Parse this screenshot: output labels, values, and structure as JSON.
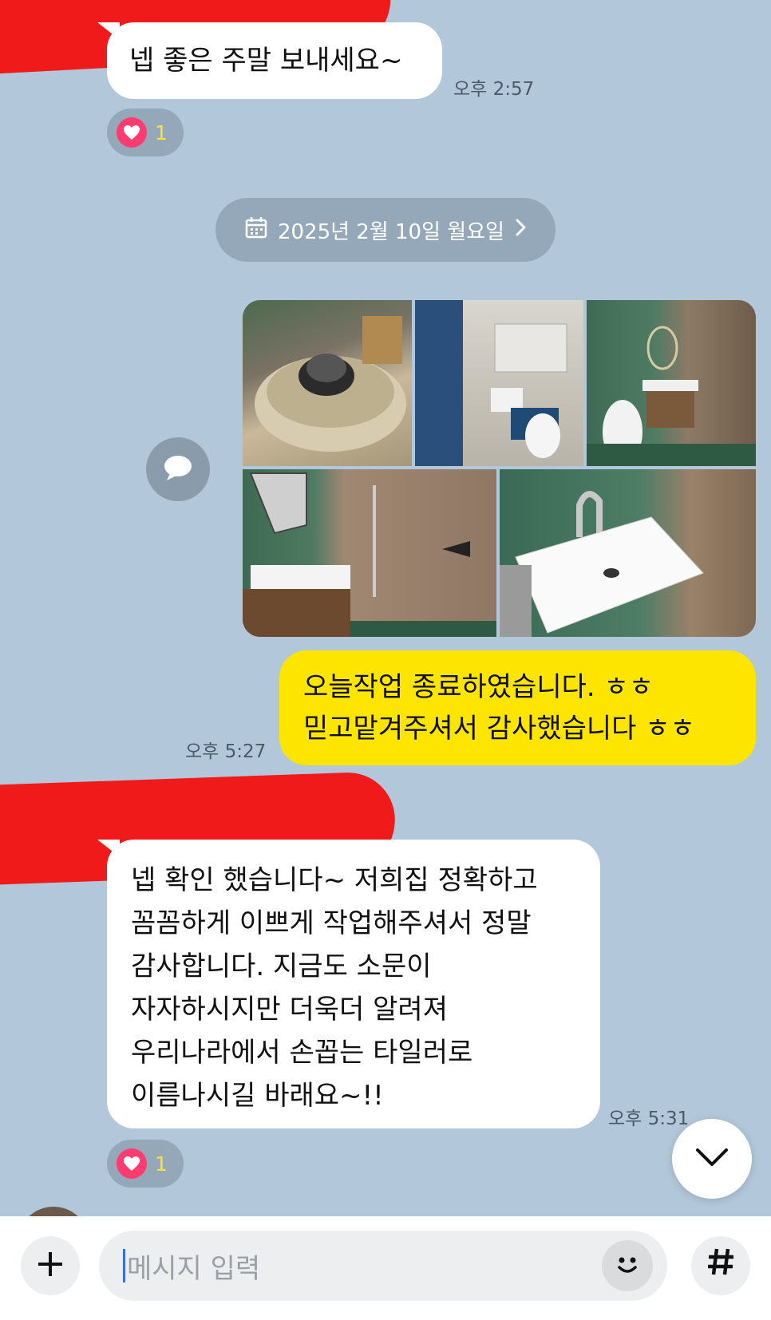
{
  "messages": [
    {
      "side": "left",
      "text": "넵 좋은 주말 보내세요~",
      "time": "오후 2:57",
      "reaction_count": "1"
    },
    {
      "side": "right",
      "lines": [
        "오늘작업 종료하였습니다. ㅎㅎ",
        "믿고맡겨주셔서 감사했습니다 ㅎㅎ"
      ],
      "time": "오후 5:27"
    },
    {
      "side": "left",
      "lines": [
        "넵 확인 했습니다~ 저희집 정확하고",
        "꼼꼼하게 이쁘게 작업해주셔서 정말",
        "감사합니다. 지금도 소문이",
        "자자하시지만 더욱더 알려져",
        "우리나라에서 손꼽는 타일러로",
        "이름나시길 바래요~!!"
      ],
      "time": "오후 5:31",
      "reaction_count": "1"
    }
  ],
  "date_divider": "2025년 2월 10일 월요일",
  "input": {
    "placeholder": "메시지 입력"
  },
  "colors": {
    "background": "#b2c7da",
    "my_bubble": "#fee500",
    "other_bubble": "#ffffff",
    "heart": "#ff3b6f"
  },
  "icons": [
    "calendar-icon",
    "chevron-right-icon",
    "share-bubble-icon",
    "heart-icon",
    "chevron-down-icon",
    "plus-icon",
    "emoji-icon",
    "hash-icon"
  ]
}
